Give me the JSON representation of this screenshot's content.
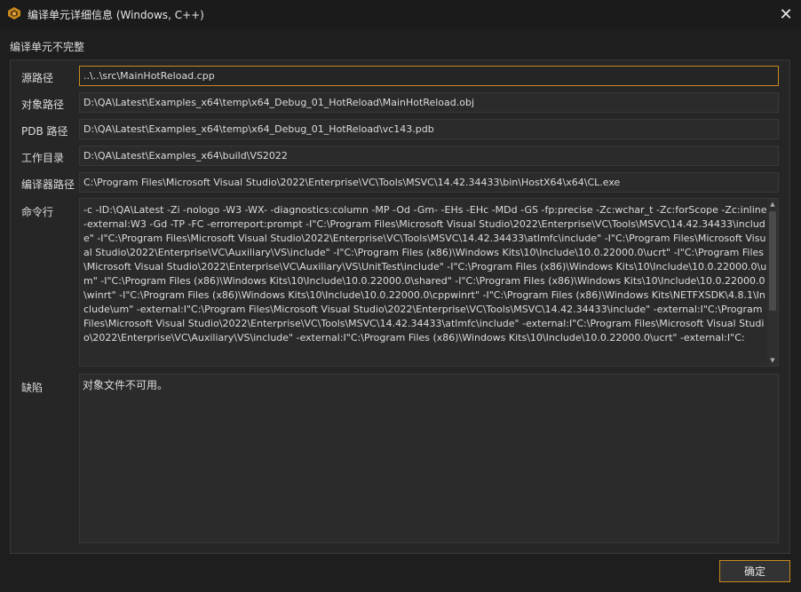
{
  "window": {
    "title": "编译单元详细信息 (Windows, C++)",
    "app_icon": "app-logo-icon",
    "close_glyph": "✕"
  },
  "status": "编译单元不完整",
  "fields": {
    "source_path": {
      "label": "源路径",
      "value": "..\\..\\src\\MainHotReload.cpp"
    },
    "object_path": {
      "label": "对象路径",
      "value": "D:\\QA\\Latest\\Examples_x64\\temp\\x64_Debug_01_HotReload\\MainHotReload.obj"
    },
    "pdb_path": {
      "label": "PDB 路径",
      "value": "D:\\QA\\Latest\\Examples_x64\\temp\\x64_Debug_01_HotReload\\vc143.pdb"
    },
    "working_dir": {
      "label": "工作目录",
      "value": "D:\\QA\\Latest\\Examples_x64\\build\\VS2022"
    },
    "compiler_path": {
      "label": "编译器路径",
      "value": "C:\\Program Files\\Microsoft Visual Studio\\2022\\Enterprise\\VC\\Tools\\MSVC\\14.42.34433\\bin\\HostX64\\x64\\CL.exe"
    }
  },
  "command_line": {
    "label": "命令行",
    "value": "-c -ID:\\QA\\Latest -Zi -nologo -W3 -WX- -diagnostics:column -MP -Od -Gm- -EHs -EHc -MDd -GS -fp:precise -Zc:wchar_t -Zc:forScope -Zc:inline -external:W3 -Gd -TP -FC -errorreport:prompt -I\"C:\\Program Files\\Microsoft Visual Studio\\2022\\Enterprise\\VC\\Tools\\MSVC\\14.42.34433\\include\" -I\"C:\\Program Files\\Microsoft Visual Studio\\2022\\Enterprise\\VC\\Tools\\MSVC\\14.42.34433\\atlmfc\\include\" -I\"C:\\Program Files\\Microsoft Visual Studio\\2022\\Enterprise\\VC\\Auxiliary\\VS\\include\" -I\"C:\\Program Files (x86)\\Windows Kits\\10\\Include\\10.0.22000.0\\ucrt\" -I\"C:\\Program Files\\Microsoft Visual Studio\\2022\\Enterprise\\VC\\Auxiliary\\VS\\UnitTest\\include\" -I\"C:\\Program Files (x86)\\Windows Kits\\10\\Include\\10.0.22000.0\\um\" -I\"C:\\Program Files (x86)\\Windows Kits\\10\\Include\\10.0.22000.0\\shared\" -I\"C:\\Program Files (x86)\\Windows Kits\\10\\Include\\10.0.22000.0\\winrt\" -I\"C:\\Program Files (x86)\\Windows Kits\\10\\Include\\10.0.22000.0\\cppwinrt\" -I\"C:\\Program Files (x86)\\Windows Kits\\NETFXSDK\\4.8.1\\Include\\um\" -external:I\"C:\\Program Files\\Microsoft Visual Studio\\2022\\Enterprise\\VC\\Tools\\MSVC\\14.42.34433\\include\" -external:I\"C:\\Program Files\\Microsoft Visual Studio\\2022\\Enterprise\\VC\\Tools\\MSVC\\14.42.34433\\atlmfc\\include\" -external:I\"C:\\Program Files\\Microsoft Visual Studio\\2022\\Enterprise\\VC\\Auxiliary\\VS\\include\" -external:I\"C:\\Program Files (x86)\\Windows Kits\\10\\Include\\10.0.22000.0\\ucrt\" -external:I\"C:"
  },
  "defect": {
    "label": "缺陷",
    "value": "对象文件不可用。"
  },
  "buttons": {
    "ok": "确定"
  },
  "colors": {
    "accent": "#c98a1e",
    "background": "#1e1e1e",
    "field_background": "#2b2b2b"
  }
}
